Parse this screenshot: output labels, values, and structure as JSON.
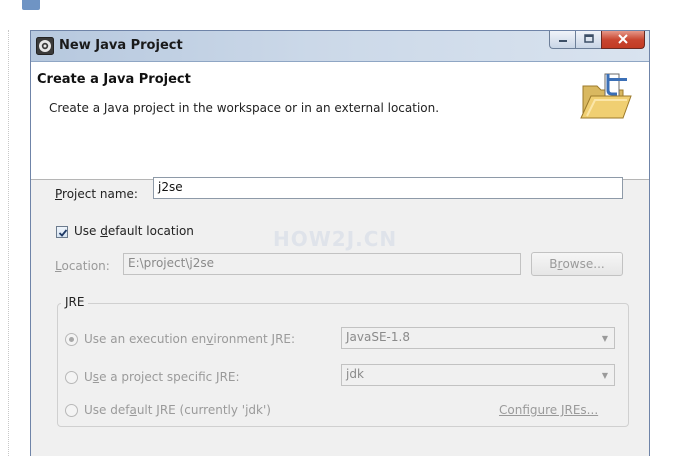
{
  "window": {
    "title": "New Java Project"
  },
  "header": {
    "title": "Create a Java Project",
    "description": "Create a Java project in the workspace or in an external location."
  },
  "project_name": {
    "label_mn": "P",
    "label_rest": "roject name:",
    "value": "j2se"
  },
  "default_location": {
    "label_pre": "Use ",
    "label_mn": "d",
    "label_rest": "efault location",
    "checked": true
  },
  "location": {
    "label_mn": "L",
    "label_rest": "ocation:",
    "value": "E:\\project\\j2se"
  },
  "browse_button": {
    "label_pre": "B",
    "label_mn": "r",
    "label_rest": "owse..."
  },
  "watermark": "HOW2J.CN",
  "jre": {
    "group_label": "JRE",
    "exec_env": {
      "label_pre": "Use an execution en",
      "label_mn": "v",
      "label_rest": "ironment JRE:",
      "value": "JavaSE-1.8",
      "selected": true
    },
    "project_specific": {
      "label_pre": "U",
      "label_mn": "s",
      "label_rest": "e a project specific JRE:",
      "value": "jdk",
      "selected": false
    },
    "default_jre": {
      "label_pre": "Use def",
      "label_mn": "a",
      "label_rest": "ult JRE (currently 'jdk')",
      "selected": false
    },
    "configure_link": "Configure JREs..."
  }
}
